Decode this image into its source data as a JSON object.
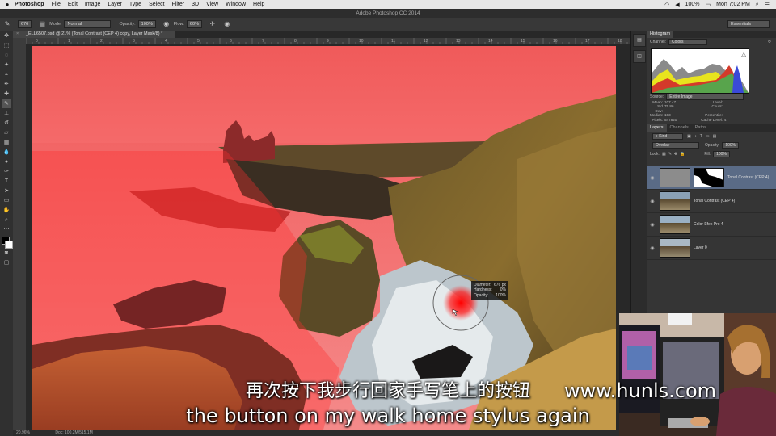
{
  "menubar": {
    "app_name": "Photoshop",
    "items": [
      "File",
      "Edit",
      "Image",
      "Layer",
      "Type",
      "Select",
      "Filter",
      "3D",
      "View",
      "Window",
      "Help"
    ],
    "battery": "100%",
    "clock": "Mon 7:02 PM"
  },
  "window_title": "Adobe Photoshop CC 2014",
  "options": {
    "brush_size": "676",
    "mode_label": "Mode:",
    "mode_value": "Normal",
    "opacity_label": "Opacity:",
    "opacity_value": "100%",
    "flow_label": "Flow:",
    "flow_value": "60%",
    "workspace": "Essentials"
  },
  "document": {
    "tab_label": "_ELL6507.psd @ 21% (Tonal Contrast (CEP 4) copy, Layer Mask/8) *",
    "zoom": "20.96%",
    "doc_size": "Doc: 100.2M/515.1M"
  },
  "brush_hud": {
    "diameter_label": "Diameter:",
    "diameter_value": "676 px",
    "hardness_label": "Hardness:",
    "hardness_value": "0%",
    "opacity_label": "Opacity:",
    "opacity_value": "100%"
  },
  "histogram": {
    "tab": "Histogram",
    "channel_label": "Channel:",
    "channel_value": "Colors",
    "source_label": "Source:",
    "source_value": "Entire Image",
    "stats": {
      "mean_label": "Mean:",
      "mean": "107.47",
      "std_label": "Std Dev:",
      "std": "75.86",
      "median_label": "Median:",
      "median": "103",
      "pixels_label": "Pixels:",
      "pixels": "547820",
      "level_label": "Level:",
      "count_label": "Count:",
      "percentile_label": "Percentile:",
      "cache_label": "Cache Level:",
      "cache": "4"
    }
  },
  "layers_panel": {
    "tabs": [
      "Layers",
      "Channels",
      "Paths"
    ],
    "kind_filter": "Kind",
    "blend_mode": "Overlay",
    "opacity_label": "Opacity:",
    "opacity_value": "100%",
    "lock_label": "Lock:",
    "fill_label": "Fill:",
    "fill_value": "100%",
    "layers": [
      {
        "name": "Tonal Contrast (CEP 4)"
      },
      {
        "name": "Tonal Contrast (CEP 4)"
      },
      {
        "name": "Color Efex Pro 4"
      },
      {
        "name": "Layer 0"
      }
    ]
  },
  "subtitles": {
    "chinese": "再次按下我步行回家手写笔上的按钮",
    "english": "the button on my walk home stylus again"
  },
  "watermark": "www.hunls.com",
  "colors": {
    "mask_overlay": "#ff3b3b",
    "panel_bg": "#353535",
    "selected_layer": "#5a6b86"
  }
}
